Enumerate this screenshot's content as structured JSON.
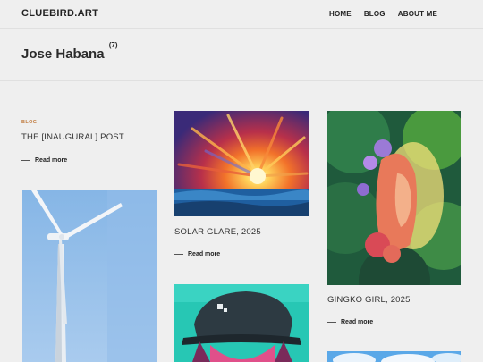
{
  "site": {
    "brand": "CLUEBIRD.ART"
  },
  "nav": {
    "items": [
      "HOME",
      "BLOG",
      "ABOUT ME"
    ]
  },
  "page": {
    "title": "Jose Habana",
    "count": "(7)"
  },
  "posts": [
    {
      "category": "BLOG",
      "title": "THE [INAUGURAL] POST",
      "more": "Read more"
    },
    {
      "title": "SOLAR GLARE, 2025",
      "more": "Read more"
    },
    {
      "title": "GINGKO GIRL, 2025",
      "more": "Read more"
    }
  ],
  "images": {
    "solar_glare": "Solar Glare painting",
    "gingko_girl": "Gingko Girl painting",
    "wind_turbine": "Wind turbine painting",
    "sgt_pepper": "Sgt. Pepper helmet painting",
    "sky": "Sky painting"
  },
  "colors": {
    "accent": "#c07a3d",
    "background": "#efefef"
  }
}
